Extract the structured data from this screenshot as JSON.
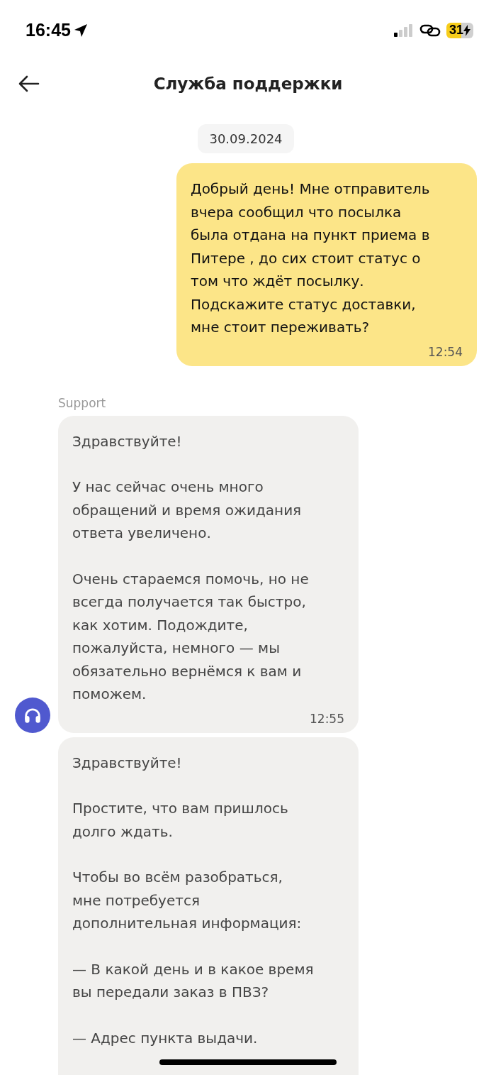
{
  "status_bar": {
    "time": "16:45",
    "battery": "31",
    "charging": true
  },
  "header": {
    "title": "Служба поддержки"
  },
  "date": "30.09.2024",
  "messages": [
    {
      "kind": "outgoing",
      "paragraphs": [
        "Добрый день! Мне отправитель\nвчера сообщил что посылка\nбыла отдана на пункт приема в\nПитере , до сих стоит статус о\nтом что ждёт посылку.\nПодскажите статус доставки,\nмне стоит переживать?"
      ],
      "time": "12:54"
    },
    {
      "kind": "incoming",
      "sender": "Support",
      "avatar": true,
      "paragraphs": [
        "Здравствуйте!",
        "У нас сейчас очень много\nобращений и время ожидания\nответа увеличено.",
        "Очень стараемся помочь, но не\nвсегда получается так быстро,\nкак хотим. Подождите,\nпожалуйста, немного — мы\nобязательно вернёмся к вам и\nпоможем."
      ],
      "time": "12:55"
    },
    {
      "kind": "incoming",
      "avatar": false,
      "paragraphs": [
        "Здравствуйте!",
        "Простите, что вам пришлось\nдолго ждать.",
        "Чтобы во всём разобраться,\nмне потребуется\nдополнительная информация:",
        "— В какой день и в какое время\nвы передали заказ в ПВЗ?",
        "— Адрес пункта выдачи."
      ]
    }
  ]
}
